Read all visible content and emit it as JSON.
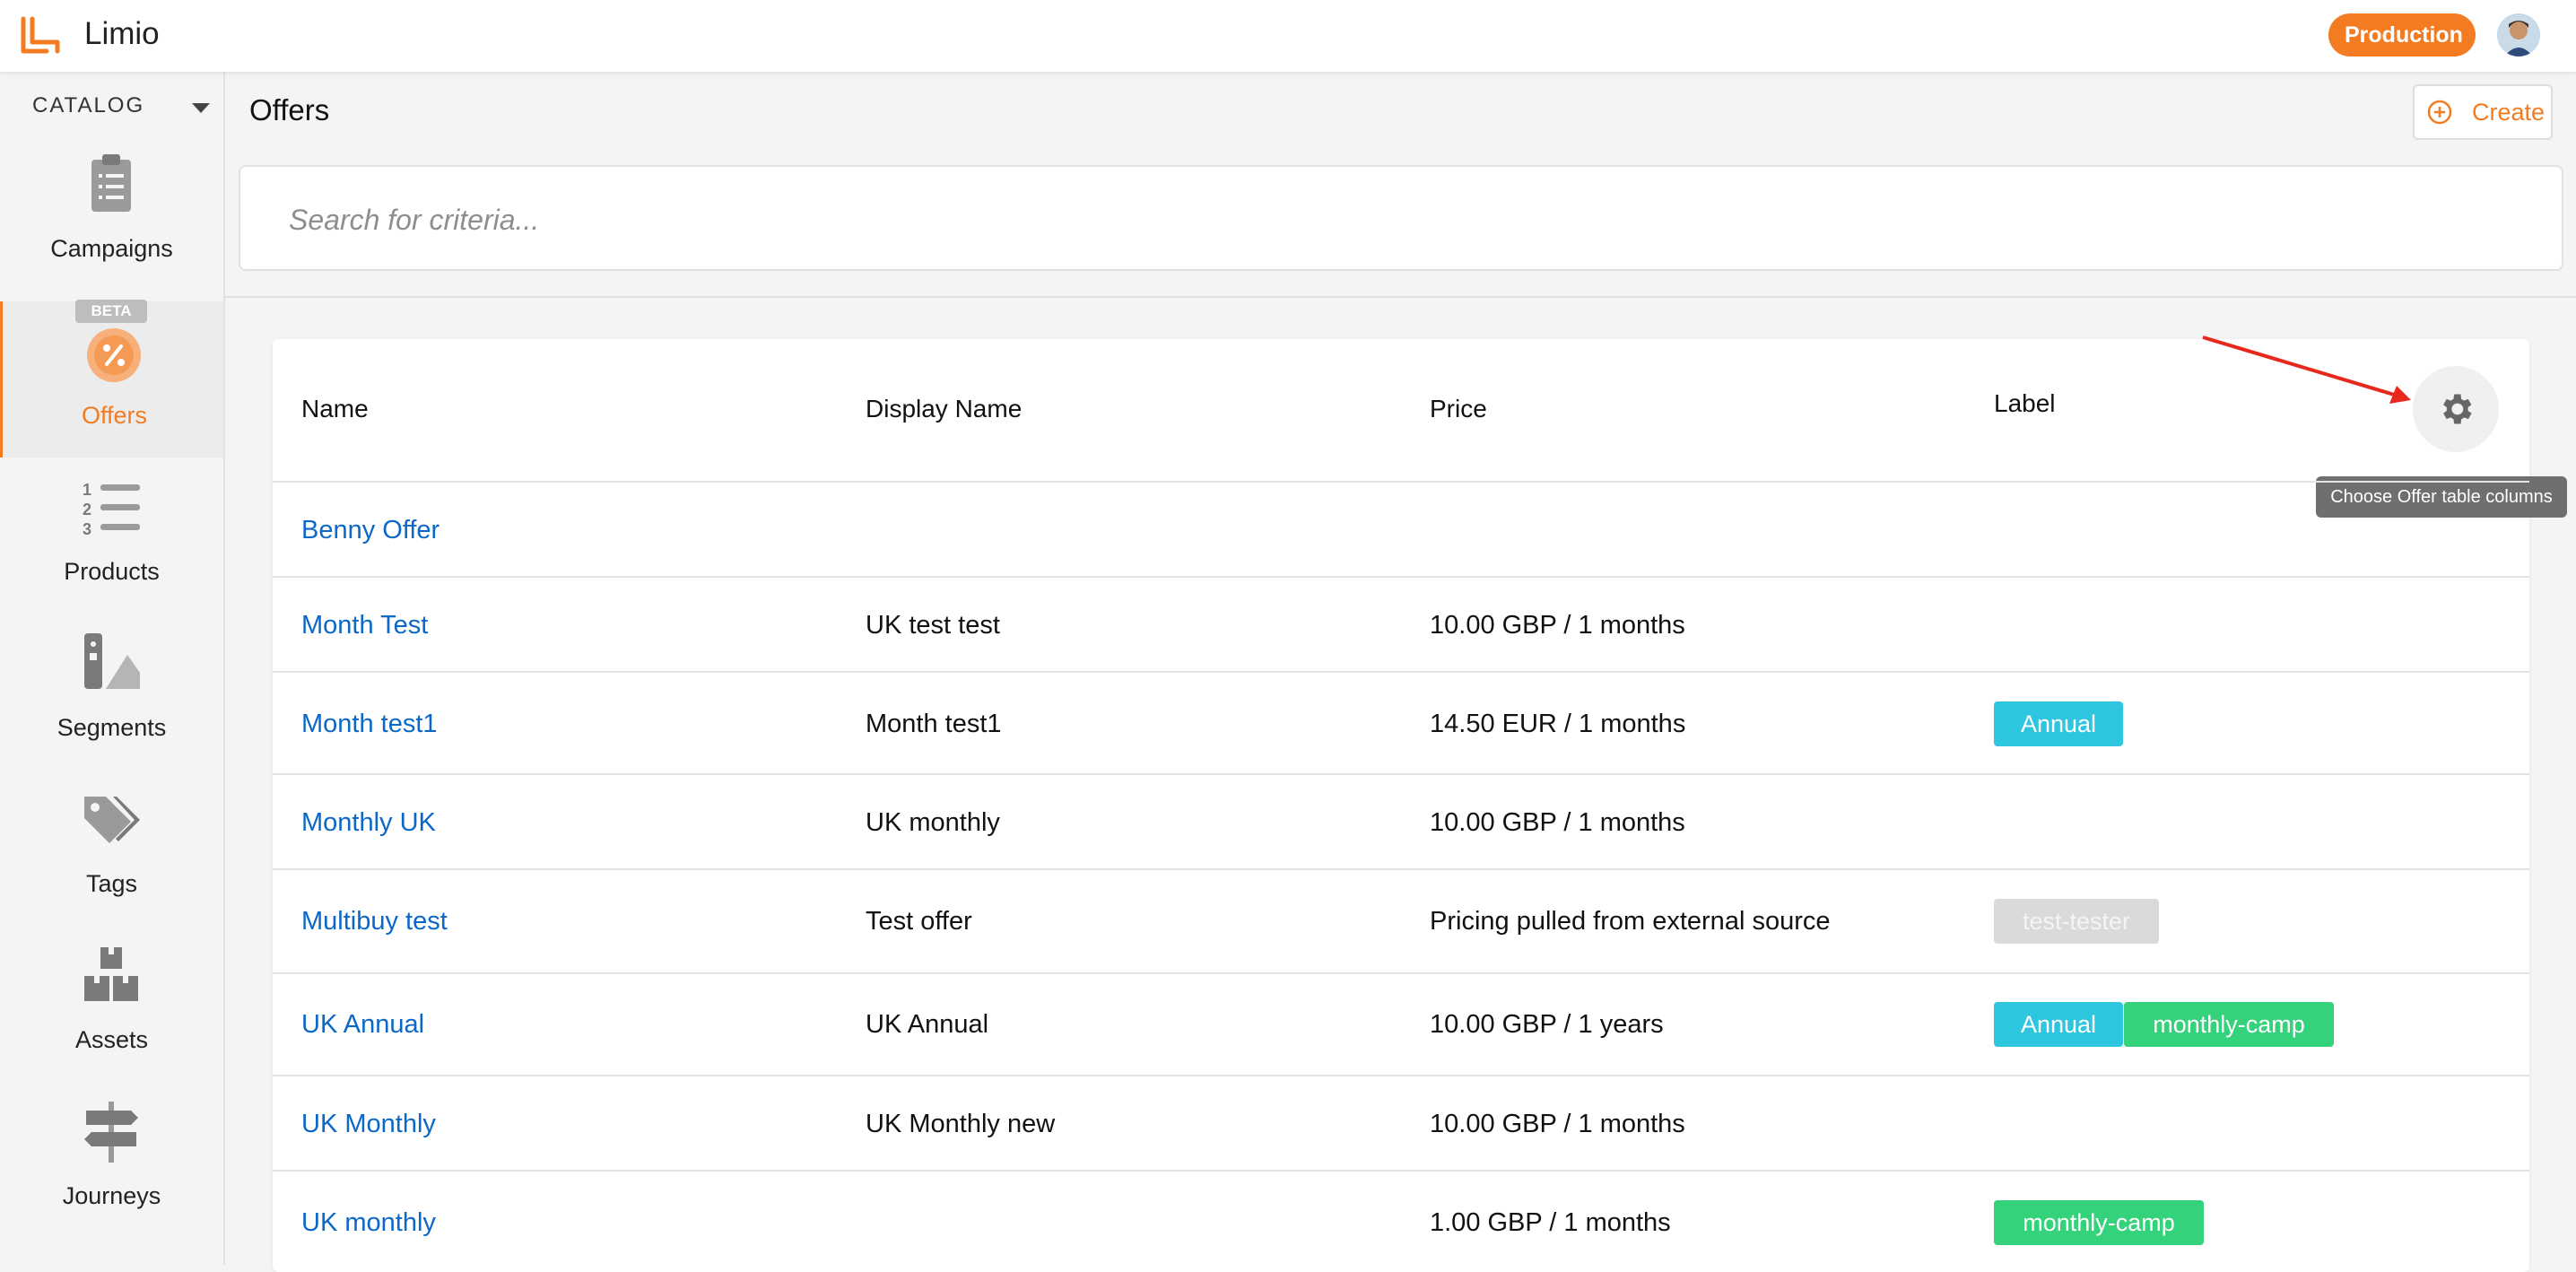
{
  "app": {
    "name": "Limio",
    "environment": "Production"
  },
  "sidebar": {
    "section": "CATALOG",
    "items": [
      {
        "label": "Campaigns",
        "icon": "clipboard-icon"
      },
      {
        "label": "Offers",
        "icon": "percent-badge-icon",
        "badge": "BETA",
        "active": true
      },
      {
        "label": "Products",
        "icon": "numbered-list-icon"
      },
      {
        "label": "Segments",
        "icon": "swatch-icon"
      },
      {
        "label": "Tags",
        "icon": "tag-icon"
      },
      {
        "label": "Assets",
        "icon": "boxes-icon"
      },
      {
        "label": "Journeys",
        "icon": "signpost-icon"
      }
    ]
  },
  "main": {
    "title": "Offers",
    "create_label": "Create",
    "search": {
      "placeholder": "Search for criteria...",
      "value": ""
    },
    "table": {
      "columns": [
        "Name",
        "Display Name",
        "Price",
        "Label"
      ],
      "settings_tooltip": "Choose Offer table columns",
      "rows": [
        {
          "name": "Benny Offer",
          "display": "",
          "price": "",
          "labels": []
        },
        {
          "name": "Month Test",
          "display": "UK test test",
          "price": "10.00 GBP / 1 months",
          "labels": []
        },
        {
          "name": "Month test1",
          "display": "Month test1",
          "price": "14.50 EUR / 1 months",
          "labels": [
            "Annual"
          ]
        },
        {
          "name": "Monthly UK",
          "display": "UK monthly",
          "price": "10.00 GBP / 1 months",
          "labels": []
        },
        {
          "name": "Multibuy test",
          "display": "Test offer",
          "price": "Pricing pulled from external source",
          "labels": [
            "test-tester"
          ]
        },
        {
          "name": "UK Annual",
          "display": "UK Annual",
          "price": "10.00 GBP / 1 years",
          "labels": [
            "Annual",
            "monthly-camp"
          ]
        },
        {
          "name": "UK Monthly",
          "display": "UK Monthly new",
          "price": "10.00 GBP / 1 months",
          "labels": []
        },
        {
          "name": "UK monthly",
          "display": "",
          "price": "1.00 GBP / 1 months",
          "labels": [
            "monthly-camp"
          ]
        }
      ]
    }
  },
  "colors": {
    "accent": "#f37c22",
    "link": "#0b67c8",
    "annual": "#2ec6df",
    "camp": "#34d27b",
    "annotation": "#e8281c"
  }
}
